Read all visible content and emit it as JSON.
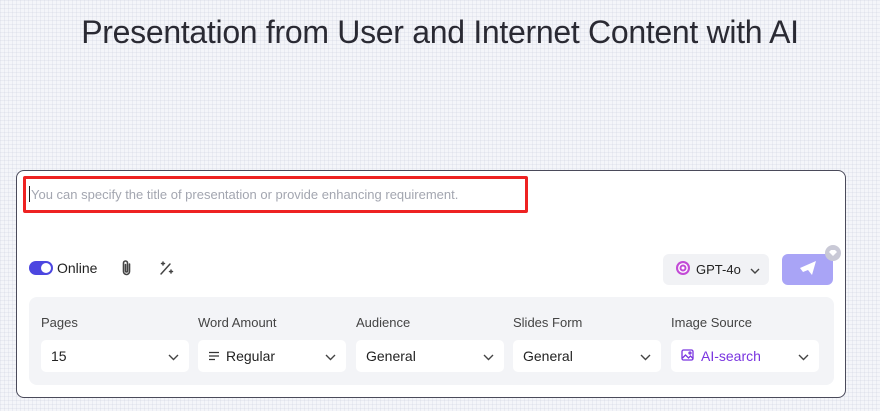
{
  "header": {
    "title": "Presentation from User and Internet Content with AI"
  },
  "prompt": {
    "placeholder": "You can specify the title of presentation or provide enhancing requirement.",
    "value": ""
  },
  "toolbar": {
    "online_label": "Online",
    "online_enabled": true,
    "model_label": "GPT-4o"
  },
  "options": {
    "pages": {
      "label": "Pages",
      "value": "15"
    },
    "word_amount": {
      "label": "Word Amount",
      "value": "Regular"
    },
    "audience": {
      "label": "Audience",
      "value": "General"
    },
    "slides_form": {
      "label": "Slides Form",
      "value": "General"
    },
    "image_source": {
      "label": "Image Source",
      "value": "AI-search"
    }
  },
  "colors": {
    "accent": "#4c46e0",
    "send_button": "#a9a4f6",
    "highlight_border": "#ee2222",
    "ai_purple": "#7a35e0"
  },
  "icons": [
    "paperclip-icon",
    "magic-wand-icon",
    "openai-icon",
    "chevron-down-icon",
    "send-icon",
    "diamond-icon",
    "lines-icon",
    "image-icon"
  ]
}
